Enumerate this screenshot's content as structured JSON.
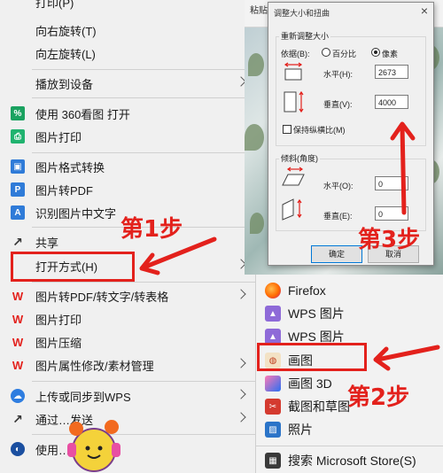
{
  "context_menu": {
    "items": [
      {
        "label": "打印(P)",
        "icon": "none"
      },
      {
        "label": "向右旋转(T)",
        "icon": "none"
      },
      {
        "label": "向左旋转(L)",
        "icon": "none"
      },
      {
        "label": "播放到设备",
        "icon": "none",
        "submenu": true
      },
      {
        "label": "使用 360看图 打开",
        "icon": "360-viewer-icon"
      },
      {
        "label": "图片打印",
        "icon": "printer-icon"
      },
      {
        "label": "图片格式转换",
        "icon": "image-convert-icon"
      },
      {
        "label": "图片转PDF",
        "icon": "pdf-icon"
      },
      {
        "label": "识别图片中文字",
        "icon": "ocr-icon"
      },
      {
        "label": "共享",
        "icon": "share-icon"
      },
      {
        "label": "打开方式(H)",
        "icon": "none",
        "submenu": true
      },
      {
        "label": "图片转PDF/转文字/转表格",
        "icon": "wps-icon",
        "submenu": true
      },
      {
        "label": "图片打印",
        "icon": "wps-icon"
      },
      {
        "label": "图片压缩",
        "icon": "wps-icon"
      },
      {
        "label": "图片属性修改/素材管理",
        "icon": "wps-icon",
        "submenu": true
      },
      {
        "label": "上传或同步到WPS",
        "icon": "cloud-icon",
        "submenu": true
      },
      {
        "label": "通过…发送",
        "icon": "share-icon",
        "submenu": true
      },
      {
        "label": "使用…进行扫描",
        "icon": "shield-icon"
      }
    ]
  },
  "ribbon": {
    "paste_label": "粘贴"
  },
  "resize_dialog": {
    "title": "调整大小和扭曲",
    "close": "×",
    "resize_group": "重新调整大小",
    "by_label": "依据(B):",
    "percent_label": "百分比",
    "pixels_label": "像素",
    "selected_unit": "像素",
    "horizontal_label": "水平(H):",
    "horizontal_value": "2673",
    "vertical_label": "垂直(V):",
    "vertical_value": "4000",
    "keep_ratio_label": "保持纵横比(M)",
    "keep_ratio_checked": false,
    "skew_group": "倾斜(角度)",
    "skew_h_label": "水平(O):",
    "skew_h_value": "0",
    "skew_v_label": "垂直(E):",
    "skew_v_value": "0",
    "ok_label": "确定",
    "cancel_label": "取消"
  },
  "open_with_submenu": {
    "items": [
      {
        "label": "Firefox",
        "icon": "firefox-icon"
      },
      {
        "label": "WPS 图片",
        "icon": "wps-pictures-icon"
      },
      {
        "label": "WPS 图片",
        "icon": "wps-pictures-icon"
      },
      {
        "label": "画图",
        "icon": "paint-icon"
      },
      {
        "label": "画图 3D",
        "icon": "paint-3d-icon"
      },
      {
        "label": "截图和草图",
        "icon": "snip-sketch-icon"
      },
      {
        "label": "照片",
        "icon": "photos-icon"
      },
      {
        "label": "搜索 Microsoft Store(S)",
        "icon": "store-icon"
      }
    ]
  },
  "annotations": {
    "step1": "第1步",
    "step2": "第2步",
    "step3": "第3步",
    "color": "#e3211c"
  }
}
